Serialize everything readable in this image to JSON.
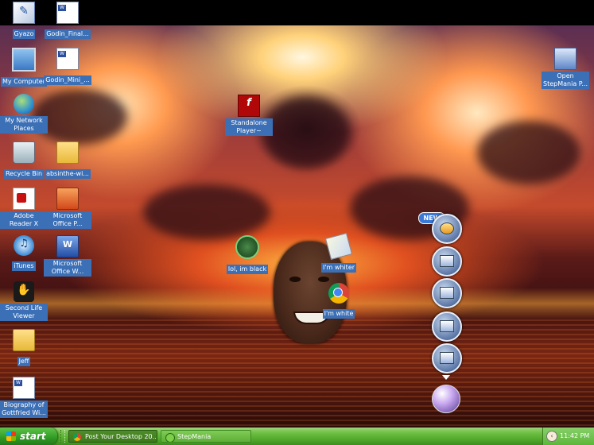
{
  "desktop": {
    "icons": [
      {
        "label": "Gyazo",
        "icon": "gyazo-icon"
      },
      {
        "label": "Godin_Final...",
        "icon": "word-doc-icon"
      },
      {
        "label": "My Computer",
        "icon": "computer-icon"
      },
      {
        "label": "Godin_Mini_...",
        "icon": "word-doc-icon"
      },
      {
        "label": "My Network Places",
        "icon": "network-icon"
      },
      {
        "label": "Standalone Player~",
        "icon": "flash-icon"
      },
      {
        "label": "Open StepMania P...",
        "icon": "stepmania-icon"
      },
      {
        "label": "Recycle Bin",
        "icon": "recycle-bin-icon"
      },
      {
        "label": "absinthe-wi...",
        "icon": "folder-icon"
      },
      {
        "label": "Adobe Reader X",
        "icon": "pdf-icon"
      },
      {
        "label": "Microsoft Office P...",
        "icon": "powerpoint-icon"
      },
      {
        "label": "iTunes",
        "icon": "itunes-icon"
      },
      {
        "label": "Microsoft Office W...",
        "icon": "word-icon"
      },
      {
        "label": "lol, im black",
        "icon": "green-app-icon"
      },
      {
        "label": "I'm whiter",
        "icon": "paper-icon"
      },
      {
        "label": "I'm white",
        "icon": "chrome-icon"
      },
      {
        "label": "Second Life Viewer",
        "icon": "second-life-icon"
      },
      {
        "label": "Jeff",
        "icon": "folder-icon"
      },
      {
        "label": "Biography of Gottfried Wi...",
        "icon": "word-doc-icon"
      }
    ]
  },
  "dock": {
    "new_badge": "NEW"
  },
  "taskbar": {
    "start_label": "start",
    "tasks": [
      {
        "label": "Post Your Desktop 20...",
        "active": true
      },
      {
        "label": "StepMania",
        "active": false
      }
    ],
    "clock": "11:42 PM"
  },
  "colors": {
    "taskbar_green": "#4fa82a",
    "icon_label_highlight": "#3b6fb6"
  }
}
